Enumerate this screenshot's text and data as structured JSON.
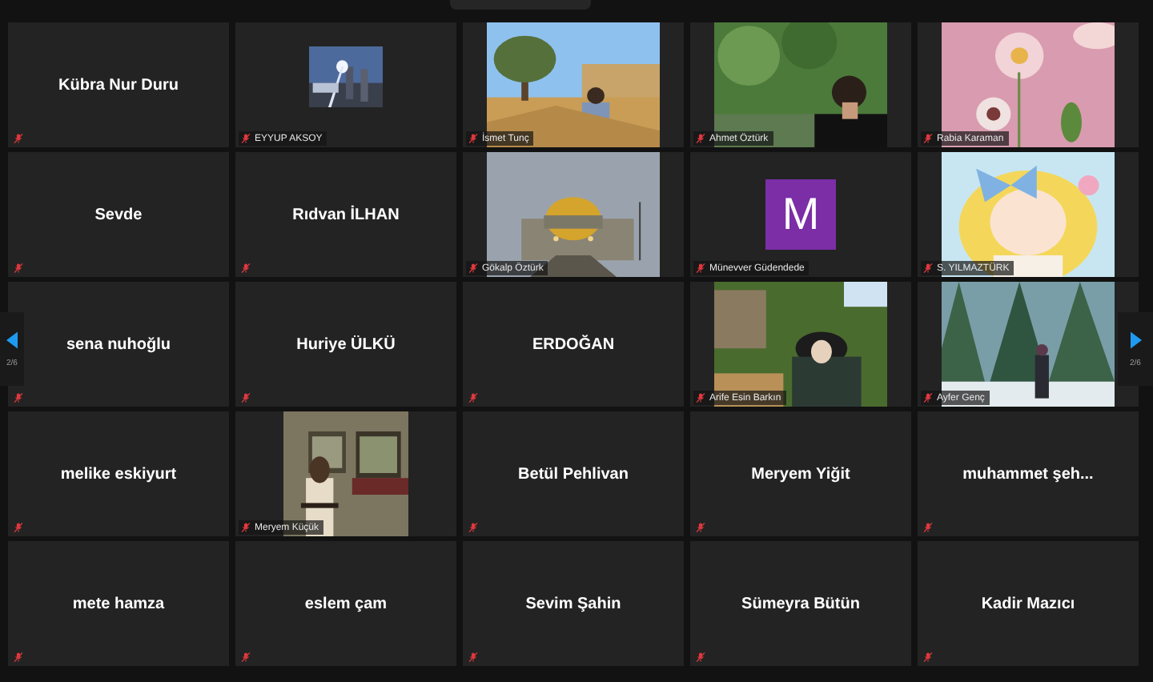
{
  "pager": {
    "left": "2/6",
    "right": "2/6"
  },
  "tiles": [
    {
      "kind": "name",
      "name": "Kübra Nur Duru",
      "muted": true
    },
    {
      "kind": "picture",
      "name": "EYYUP AKSOY",
      "muted": true
    },
    {
      "kind": "picture",
      "name": "İsmet Tunç",
      "muted": true
    },
    {
      "kind": "picture",
      "name": "Ahmet Öztürk",
      "muted": true
    },
    {
      "kind": "picture",
      "name": "Rabia Karaman",
      "muted": true
    },
    {
      "kind": "name",
      "name": "Sevde",
      "muted": true
    },
    {
      "kind": "name",
      "name": "Rıdvan İLHAN",
      "muted": true
    },
    {
      "kind": "picture",
      "name": "Gökalp Öztürk",
      "muted": true
    },
    {
      "kind": "avatar",
      "initial": "M",
      "name": "Münevver Güdendede",
      "muted": true
    },
    {
      "kind": "picture",
      "name": "S. YILMAZTÜRK",
      "muted": true
    },
    {
      "kind": "name",
      "name": "sena nuhoğlu",
      "muted": true
    },
    {
      "kind": "name",
      "name": "Huriye ÜLKÜ",
      "muted": true
    },
    {
      "kind": "name",
      "name": "ERDOĞAN",
      "muted": true
    },
    {
      "kind": "picture",
      "name": "Arife Esin Barkın",
      "muted": true
    },
    {
      "kind": "picture",
      "name": "Ayfer Genç",
      "muted": true
    },
    {
      "kind": "name",
      "name": "melike eskiyurt",
      "muted": true
    },
    {
      "kind": "picture",
      "name": "Meryem Küçük",
      "muted": true
    },
    {
      "kind": "name",
      "name": "Betül Pehlivan",
      "muted": true
    },
    {
      "kind": "name",
      "name": "Meryem Yiğit",
      "muted": true
    },
    {
      "kind": "name",
      "name": "muhammet  şeh...",
      "muted": true
    },
    {
      "kind": "name",
      "name": "mete hamza",
      "muted": true
    },
    {
      "kind": "name",
      "name": "eslem çam",
      "muted": true
    },
    {
      "kind": "name",
      "name": "Sevim Şahin",
      "muted": true
    },
    {
      "kind": "name",
      "name": "Sümeyra Bütün",
      "muted": true
    },
    {
      "kind": "name",
      "name": "Kadir Mazıcı",
      "muted": true
    }
  ]
}
